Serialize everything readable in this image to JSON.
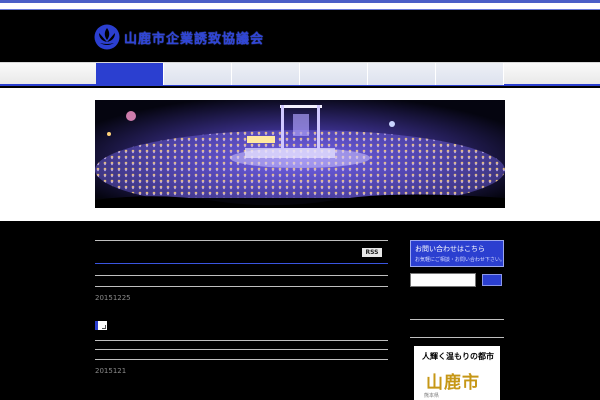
{
  "header": {
    "site_title": "山鹿市企業誘致協議会"
  },
  "nav": {
    "items": [
      "",
      "",
      "",
      "",
      "",
      ""
    ],
    "active_index": 0
  },
  "posts": {
    "rss_label": "RSS",
    "entries": [
      {
        "date": "20151225"
      },
      {
        "date": "2015121"
      }
    ]
  },
  "sidebar": {
    "contact_title": "お問い合わせはこちら",
    "contact_subtitle": "お気軽にご相談・お問い合わせ下さい。",
    "banner_tagline": "人輝く温もりの都市",
    "banner_city": "山鹿市",
    "banner_sub": "熊本県"
  },
  "colors": {
    "accent": "#2b3fd0",
    "banner_gold": "#c69716"
  }
}
